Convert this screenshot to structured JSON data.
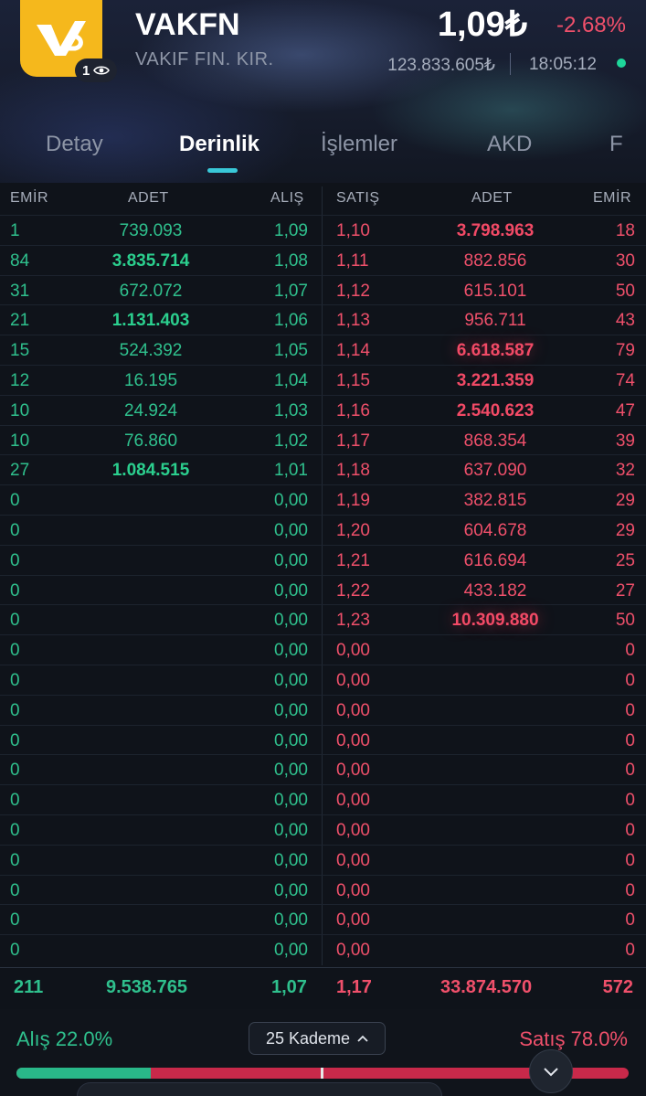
{
  "header": {
    "ticker": "VAKFN",
    "company": "VAKIF FIN. KIR.",
    "price": "1,09₺",
    "change": "-2.68%",
    "volume": "123.833.605₺",
    "time": "18:05:12",
    "watch_count": "1",
    "colors": {
      "logo": "#f5b81c",
      "up": "#2fc08d",
      "down": "#f0506b",
      "live": "#1ed69a"
    }
  },
  "tabs": [
    "Detay",
    "Derinlik",
    "İşlemler",
    "AKD",
    "F"
  ],
  "active_tab": "Derinlik",
  "columns": {
    "emir_l": "EMİR",
    "adet_l": "ADET",
    "alis": "ALIŞ",
    "satis": "SATIŞ",
    "adet_r": "ADET",
    "emir_r": "EMİR"
  },
  "rows": [
    {
      "emir_l": "1",
      "adet_l": "739.093",
      "alis": "1,09",
      "satis": "1,10",
      "adet_r": "3.798.963",
      "emir_r": "18"
    },
    {
      "emir_l": "84",
      "adet_l": "3.835.714",
      "alis": "1,08",
      "satis": "1,11",
      "adet_r": "882.856",
      "emir_r": "30"
    },
    {
      "emir_l": "31",
      "adet_l": "672.072",
      "alis": "1,07",
      "satis": "1,12",
      "adet_r": "615.101",
      "emir_r": "50"
    },
    {
      "emir_l": "21",
      "adet_l": "1.131.403",
      "alis": "1,06",
      "satis": "1,13",
      "adet_r": "956.711",
      "emir_r": "43"
    },
    {
      "emir_l": "15",
      "adet_l": "524.392",
      "alis": "1,05",
      "satis": "1,14",
      "adet_r": "6.618.587",
      "emir_r": "79"
    },
    {
      "emir_l": "12",
      "adet_l": "16.195",
      "alis": "1,04",
      "satis": "1,15",
      "adet_r": "3.221.359",
      "emir_r": "74"
    },
    {
      "emir_l": "10",
      "adet_l": "24.924",
      "alis": "1,03",
      "satis": "1,16",
      "adet_r": "2.540.623",
      "emir_r": "47"
    },
    {
      "emir_l": "10",
      "adet_l": "76.860",
      "alis": "1,02",
      "satis": "1,17",
      "adet_r": "868.354",
      "emir_r": "39"
    },
    {
      "emir_l": "27",
      "adet_l": "1.084.515",
      "alis": "1,01",
      "satis": "1,18",
      "adet_r": "637.090",
      "emir_r": "32"
    },
    {
      "emir_l": "0",
      "adet_l": "",
      "alis": "0,00",
      "satis": "1,19",
      "adet_r": "382.815",
      "emir_r": "29"
    },
    {
      "emir_l": "0",
      "adet_l": "",
      "alis": "0,00",
      "satis": "1,20",
      "adet_r": "604.678",
      "emir_r": "29"
    },
    {
      "emir_l": "0",
      "adet_l": "",
      "alis": "0,00",
      "satis": "1,21",
      "adet_r": "616.694",
      "emir_r": "25"
    },
    {
      "emir_l": "0",
      "adet_l": "",
      "alis": "0,00",
      "satis": "1,22",
      "adet_r": "433.182",
      "emir_r": "27"
    },
    {
      "emir_l": "0",
      "adet_l": "",
      "alis": "0,00",
      "satis": "1,23",
      "adet_r": "10.309.880",
      "emir_r": "50"
    },
    {
      "emir_l": "0",
      "adet_l": "",
      "alis": "0,00",
      "satis": "0,00",
      "adet_r": "",
      "emir_r": "0"
    },
    {
      "emir_l": "0",
      "adet_l": "",
      "alis": "0,00",
      "satis": "0,00",
      "adet_r": "",
      "emir_r": "0"
    },
    {
      "emir_l": "0",
      "adet_l": "",
      "alis": "0,00",
      "satis": "0,00",
      "adet_r": "",
      "emir_r": "0"
    },
    {
      "emir_l": "0",
      "adet_l": "",
      "alis": "0,00",
      "satis": "0,00",
      "adet_r": "",
      "emir_r": "0"
    },
    {
      "emir_l": "0",
      "adet_l": "",
      "alis": "0,00",
      "satis": "0,00",
      "adet_r": "",
      "emir_r": "0"
    },
    {
      "emir_l": "0",
      "adet_l": "",
      "alis": "0,00",
      "satis": "0,00",
      "adet_r": "",
      "emir_r": "0"
    },
    {
      "emir_l": "0",
      "adet_l": "",
      "alis": "0,00",
      "satis": "0,00",
      "adet_r": "",
      "emir_r": "0"
    },
    {
      "emir_l": "0",
      "adet_l": "",
      "alis": "0,00",
      "satis": "0,00",
      "adet_r": "",
      "emir_r": "0"
    },
    {
      "emir_l": "0",
      "adet_l": "",
      "alis": "0,00",
      "satis": "0,00",
      "adet_r": "",
      "emir_r": "0"
    },
    {
      "emir_l": "0",
      "adet_l": "",
      "alis": "0,00",
      "satis": "0,00",
      "adet_r": "",
      "emir_r": "0"
    },
    {
      "emir_l": "0",
      "adet_l": "",
      "alis": "0,00",
      "satis": "0,00",
      "adet_r": "",
      "emir_r": "0"
    }
  ],
  "bold_left": [
    1,
    3,
    8
  ],
  "bold_right": [
    0,
    4,
    5,
    6,
    13
  ],
  "glow_right": [
    4,
    13
  ],
  "totals": {
    "emir_l": "211",
    "adet_l": "9.538.765",
    "alis": "1,07",
    "satis": "1,17",
    "adet_r": "33.874.570",
    "emir_r": "572"
  },
  "footer": {
    "alis_label": "Alış 22.0%",
    "satis_label": "Satış 78.0%",
    "kademe_label": "25 Kademe",
    "alis_ratio": 0.22
  }
}
